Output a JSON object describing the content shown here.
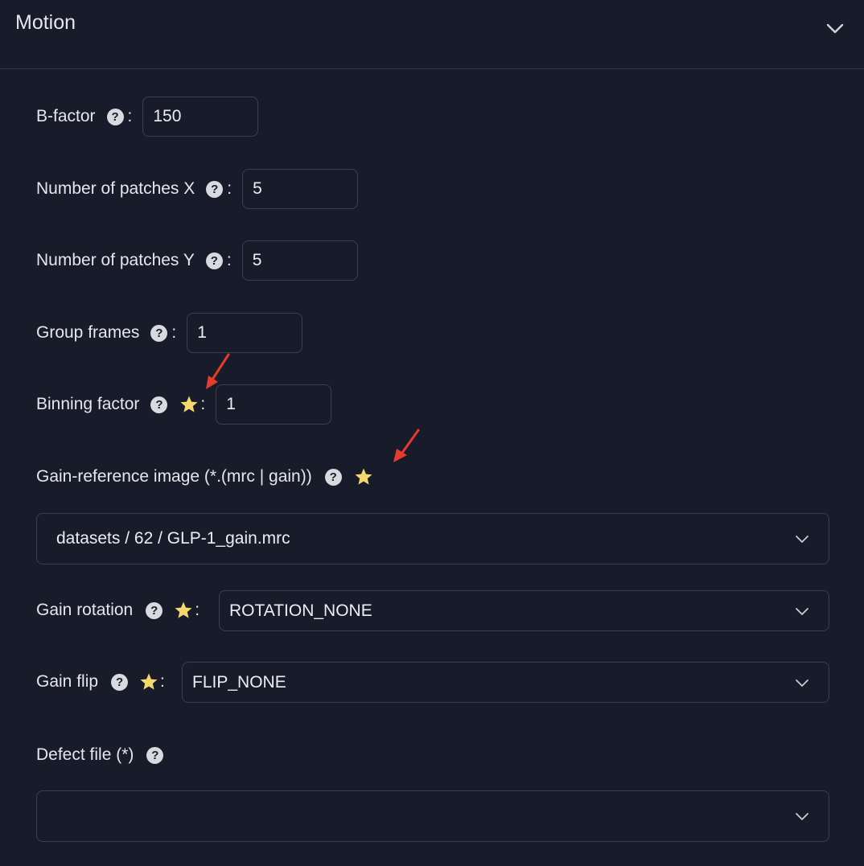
{
  "panel": {
    "title": "Motion"
  },
  "fields": {
    "bfactor": {
      "label": "B-factor",
      "value": "150"
    },
    "patches_x": {
      "label": "Number of patches X",
      "value": "5"
    },
    "patches_y": {
      "label": "Number of patches Y",
      "value": "5"
    },
    "group_frames": {
      "label": "Group frames",
      "value": "1"
    },
    "binning_factor": {
      "label": "Binning factor",
      "value": "1"
    },
    "gain_reference": {
      "label": "Gain-reference image (*.(mrc | gain))",
      "value": "datasets / 62 / GLP-1_gain.mrc"
    },
    "gain_rotation": {
      "label": "Gain rotation",
      "value": "ROTATION_NONE"
    },
    "gain_flip": {
      "label": "Gain flip",
      "value": "FLIP_NONE"
    },
    "defect_file": {
      "label": "Defect file (*)",
      "value": ""
    }
  },
  "common": {
    "help_glyph": "?",
    "colon": ":"
  },
  "colors": {
    "background": "#171b2a",
    "border": "#3b3f50",
    "star": "#f5d76e",
    "annotation_arrow": "#e53b2c"
  },
  "icons": {
    "help": "question-circle-icon",
    "star": "star-icon",
    "dropdown": "chevron-down-icon",
    "collapse": "chevron-down-icon"
  }
}
